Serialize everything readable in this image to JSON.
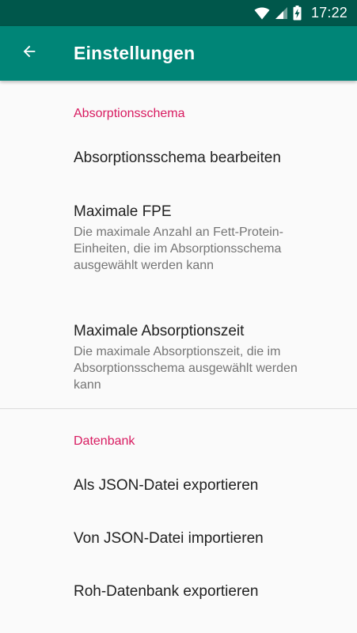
{
  "status_bar": {
    "time": "17:22",
    "icons": [
      "wifi-icon",
      "signal-icon",
      "battery-charging-icon"
    ]
  },
  "app_bar": {
    "title": "Einstellungen",
    "back_icon": "arrow-back-icon",
    "background": "#008577",
    "status_background": "#00574b"
  },
  "sections": [
    {
      "header": "Absorptionsschema",
      "items": [
        {
          "title": "Absorptionsschema bearbeiten",
          "summary": ""
        },
        {
          "title": "Maximale FPE",
          "summary": "Die maximale Anzahl an Fett-Protein-Einheiten, die im Absorptionsschema ausgewählt werden kann"
        },
        {
          "title": "Maximale Absorptionszeit",
          "summary": "Die maximale Absorptionszeit, die im Absorptionsschema ausgewählt werden kann"
        }
      ]
    },
    {
      "header": "Datenbank",
      "items": [
        {
          "title": "Als JSON-Datei exportieren",
          "summary": ""
        },
        {
          "title": "Von JSON-Datei importieren",
          "summary": ""
        },
        {
          "title": "Roh-Datenbank exportieren",
          "summary": ""
        }
      ]
    }
  ],
  "colors": {
    "accent": "#d81b60",
    "primary": "#008577",
    "primary_dark": "#00574b"
  }
}
